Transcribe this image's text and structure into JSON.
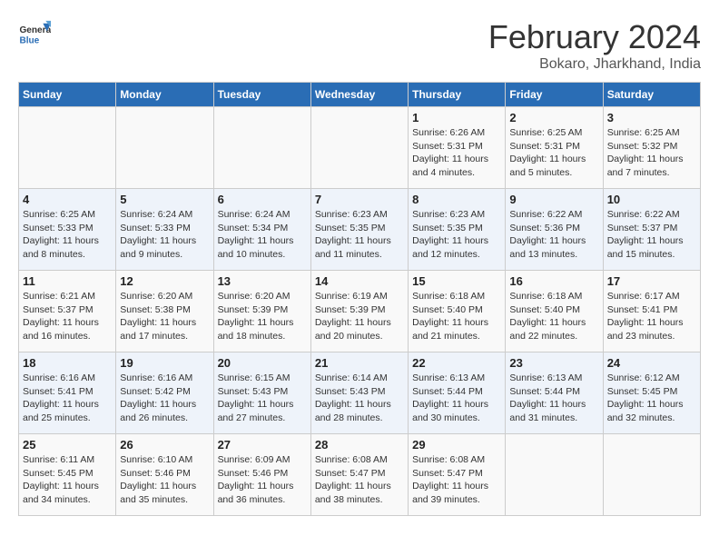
{
  "header": {
    "logo_line1": "General",
    "logo_line2": "Blue",
    "title": "February 2024",
    "subtitle": "Bokaro, Jharkhand, India"
  },
  "days_of_week": [
    "Sunday",
    "Monday",
    "Tuesday",
    "Wednesday",
    "Thursday",
    "Friday",
    "Saturday"
  ],
  "weeks": [
    [
      {
        "day": "",
        "info": ""
      },
      {
        "day": "",
        "info": ""
      },
      {
        "day": "",
        "info": ""
      },
      {
        "day": "",
        "info": ""
      },
      {
        "day": "1",
        "info": "Sunrise: 6:26 AM\nSunset: 5:31 PM\nDaylight: 11 hours\nand 4 minutes."
      },
      {
        "day": "2",
        "info": "Sunrise: 6:25 AM\nSunset: 5:31 PM\nDaylight: 11 hours\nand 5 minutes."
      },
      {
        "day": "3",
        "info": "Sunrise: 6:25 AM\nSunset: 5:32 PM\nDaylight: 11 hours\nand 7 minutes."
      }
    ],
    [
      {
        "day": "4",
        "info": "Sunrise: 6:25 AM\nSunset: 5:33 PM\nDaylight: 11 hours\nand 8 minutes."
      },
      {
        "day": "5",
        "info": "Sunrise: 6:24 AM\nSunset: 5:33 PM\nDaylight: 11 hours\nand 9 minutes."
      },
      {
        "day": "6",
        "info": "Sunrise: 6:24 AM\nSunset: 5:34 PM\nDaylight: 11 hours\nand 10 minutes."
      },
      {
        "day": "7",
        "info": "Sunrise: 6:23 AM\nSunset: 5:35 PM\nDaylight: 11 hours\nand 11 minutes."
      },
      {
        "day": "8",
        "info": "Sunrise: 6:23 AM\nSunset: 5:35 PM\nDaylight: 11 hours\nand 12 minutes."
      },
      {
        "day": "9",
        "info": "Sunrise: 6:22 AM\nSunset: 5:36 PM\nDaylight: 11 hours\nand 13 minutes."
      },
      {
        "day": "10",
        "info": "Sunrise: 6:22 AM\nSunset: 5:37 PM\nDaylight: 11 hours\nand 15 minutes."
      }
    ],
    [
      {
        "day": "11",
        "info": "Sunrise: 6:21 AM\nSunset: 5:37 PM\nDaylight: 11 hours\nand 16 minutes."
      },
      {
        "day": "12",
        "info": "Sunrise: 6:20 AM\nSunset: 5:38 PM\nDaylight: 11 hours\nand 17 minutes."
      },
      {
        "day": "13",
        "info": "Sunrise: 6:20 AM\nSunset: 5:39 PM\nDaylight: 11 hours\nand 18 minutes."
      },
      {
        "day": "14",
        "info": "Sunrise: 6:19 AM\nSunset: 5:39 PM\nDaylight: 11 hours\nand 20 minutes."
      },
      {
        "day": "15",
        "info": "Sunrise: 6:18 AM\nSunset: 5:40 PM\nDaylight: 11 hours\nand 21 minutes."
      },
      {
        "day": "16",
        "info": "Sunrise: 6:18 AM\nSunset: 5:40 PM\nDaylight: 11 hours\nand 22 minutes."
      },
      {
        "day": "17",
        "info": "Sunrise: 6:17 AM\nSunset: 5:41 PM\nDaylight: 11 hours\nand 23 minutes."
      }
    ],
    [
      {
        "day": "18",
        "info": "Sunrise: 6:16 AM\nSunset: 5:41 PM\nDaylight: 11 hours\nand 25 minutes."
      },
      {
        "day": "19",
        "info": "Sunrise: 6:16 AM\nSunset: 5:42 PM\nDaylight: 11 hours\nand 26 minutes."
      },
      {
        "day": "20",
        "info": "Sunrise: 6:15 AM\nSunset: 5:43 PM\nDaylight: 11 hours\nand 27 minutes."
      },
      {
        "day": "21",
        "info": "Sunrise: 6:14 AM\nSunset: 5:43 PM\nDaylight: 11 hours\nand 28 minutes."
      },
      {
        "day": "22",
        "info": "Sunrise: 6:13 AM\nSunset: 5:44 PM\nDaylight: 11 hours\nand 30 minutes."
      },
      {
        "day": "23",
        "info": "Sunrise: 6:13 AM\nSunset: 5:44 PM\nDaylight: 11 hours\nand 31 minutes."
      },
      {
        "day": "24",
        "info": "Sunrise: 6:12 AM\nSunset: 5:45 PM\nDaylight: 11 hours\nand 32 minutes."
      }
    ],
    [
      {
        "day": "25",
        "info": "Sunrise: 6:11 AM\nSunset: 5:45 PM\nDaylight: 11 hours\nand 34 minutes."
      },
      {
        "day": "26",
        "info": "Sunrise: 6:10 AM\nSunset: 5:46 PM\nDaylight: 11 hours\nand 35 minutes."
      },
      {
        "day": "27",
        "info": "Sunrise: 6:09 AM\nSunset: 5:46 PM\nDaylight: 11 hours\nand 36 minutes."
      },
      {
        "day": "28",
        "info": "Sunrise: 6:08 AM\nSunset: 5:47 PM\nDaylight: 11 hours\nand 38 minutes."
      },
      {
        "day": "29",
        "info": "Sunrise: 6:08 AM\nSunset: 5:47 PM\nDaylight: 11 hours\nand 39 minutes."
      },
      {
        "day": "",
        "info": ""
      },
      {
        "day": "",
        "info": ""
      }
    ]
  ]
}
